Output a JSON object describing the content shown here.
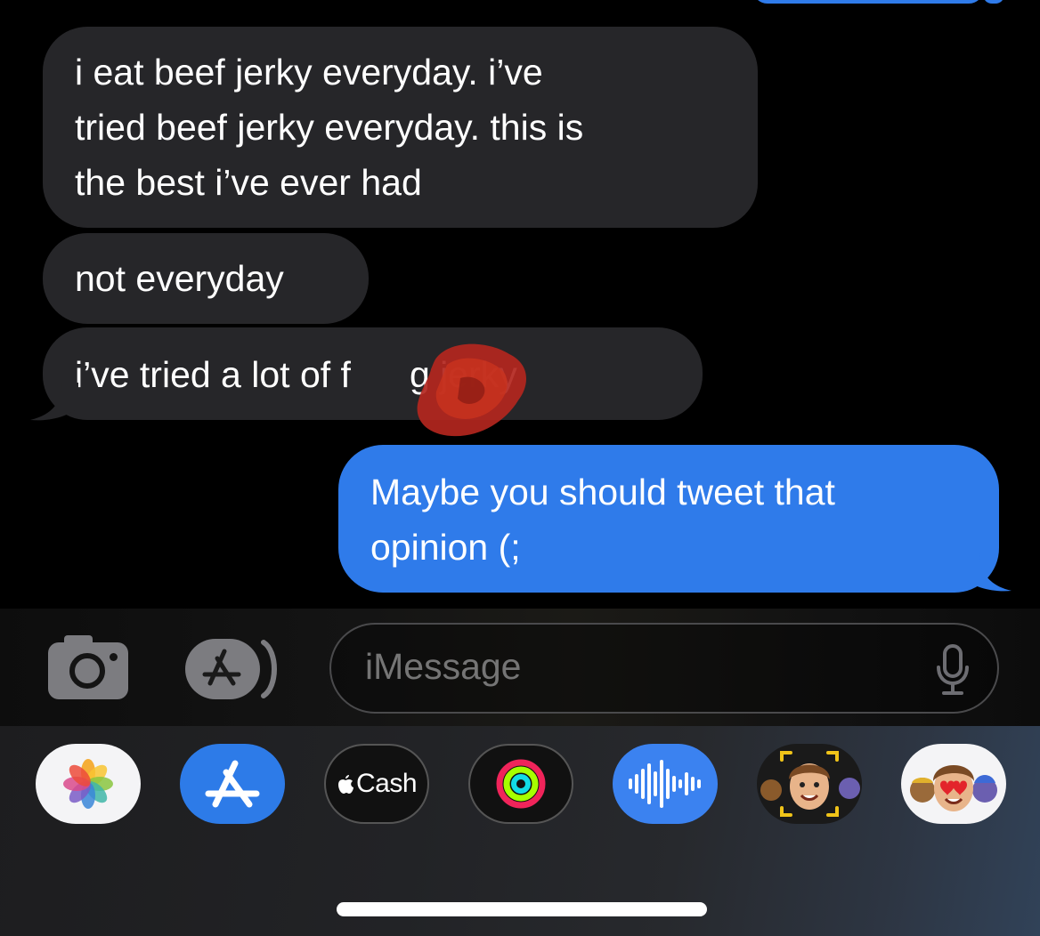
{
  "conversation": {
    "received": [
      {
        "lines": [
          "i eat beef jerky everyday. i’ve",
          "tried beef jerky everyday. this is",
          "the best i’ve ever had"
        ]
      },
      {
        "lines": [
          "not everyday"
        ]
      },
      {
        "lines": [
          "i’ve tried a lot of f",
          "g jerky"
        ]
      }
    ],
    "sent": [
      {
        "lines": [
          "Maybe you should tweet that",
          "opinion (;"
        ]
      }
    ]
  },
  "compose": {
    "placeholder": "iMessage"
  },
  "app_drawer": {
    "items": [
      {
        "name": "Photos",
        "icon": "photos-icon"
      },
      {
        "name": "App Store",
        "icon": "app-store-icon"
      },
      {
        "name": "Cash",
        "label": "Cash",
        "icon": "apple-logo-icon"
      },
      {
        "name": "Activity",
        "icon": "activity-rings-icon"
      },
      {
        "name": "Audio Message",
        "icon": "waveform-icon"
      },
      {
        "name": "Memoji Camera",
        "icon": "memoji-camera-icon"
      },
      {
        "name": "Memoji Stickers",
        "icon": "memoji-stickers-icon"
      }
    ]
  },
  "colors": {
    "sent_bubble": "#2f7bea",
    "received_bubble": "#262629",
    "background": "#000000"
  }
}
